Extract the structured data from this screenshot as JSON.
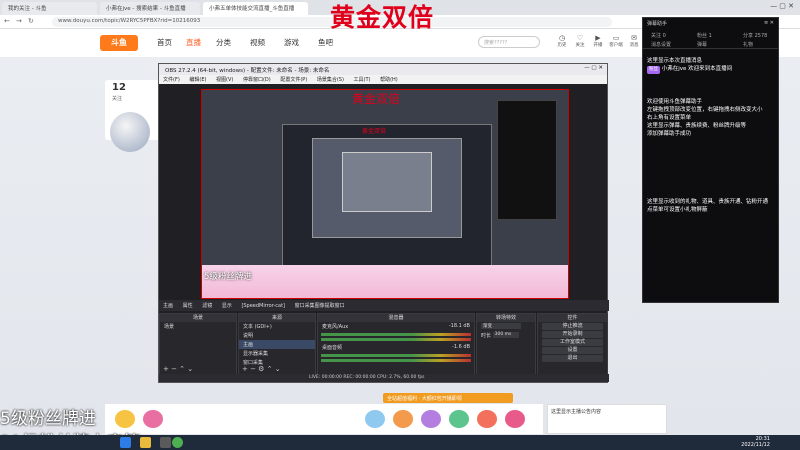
{
  "browser": {
    "tabs": [
      "我的关注 - 斗鱼",
      "小弗在jve - 搜索结果 - 斗鱼直播",
      "小弗五单体技能交流直播_斗鱼直播"
    ],
    "url": "www.douyu.com/topic/W2RYC5PFBX?rid=10216093"
  },
  "overlay": {
    "title": "黄金双倍",
    "fans_line1": "5级粉丝牌进",
    "fans_line2": "21级粉丝牌上房管"
  },
  "site": {
    "logo": "斗鱼",
    "nav": [
      "首页",
      "直播",
      "分类",
      "视频",
      "游戏",
      "鱼吧"
    ],
    "search_placeholder": "搜索?????",
    "header_icons": [
      "历史",
      "关注",
      "开播",
      "客户端",
      "消息"
    ],
    "side_count": "12",
    "side_count_label": "关注"
  },
  "obs": {
    "title": "OBS 27.2.4 (64-bit, windows) - 配置文件: 未命名 - 场景: 未命名",
    "menu": [
      "文件(F)",
      "编辑(E)",
      "视图(V)",
      "停靠窗口(D)",
      "配置文件(P)",
      "场景集合(S)",
      "工具(T)",
      "帮助(H)"
    ],
    "preview_title": "黄金双倍",
    "nested_title": "黄金双倍",
    "scene_line": [
      "主画",
      "属性",
      "滤镜",
      "显示",
      "[SpeedMirror-cat]",
      "窗口采集图像提取窗口"
    ],
    "docks": {
      "scenes": {
        "title": "场景",
        "items": [
          "场景"
        ]
      },
      "sources": {
        "title": "来源",
        "items": [
          "文本 (GDI+)",
          "说明",
          "主画",
          "显示器采集",
          "窗口采集"
        ]
      },
      "mixer": {
        "title": "混音器",
        "items": [
          "麦克风/Aux",
          "桌面音频"
        ],
        "levels": [
          "-18.1 dB",
          "-1.6 dB"
        ]
      },
      "transitions": {
        "title": "转场特效",
        "items": [
          "渐变",
          "时长"
        ],
        "duration": "300 ms"
      },
      "controls": {
        "title": "控件",
        "buttons": [
          "停止推流",
          "开始录制",
          "工作室模式",
          "设置",
          "退出"
        ]
      }
    },
    "status": "LIVE: 00:00:00  REC: 00:00:00  CPU: 2.7%, 60.00 fps"
  },
  "chat": {
    "header": "弹幕助手",
    "tabs": [
      "关注",
      "粉丝",
      "分享"
    ],
    "tab_values": [
      "0",
      "1",
      "2578"
    ],
    "sub_tabs": [
      "消息设置",
      "弹幕",
      "礼物"
    ],
    "messages": [
      "这里显示本次直播消息",
      "小弗在jve 欢迎来到本直播间",
      "欢迎使用斗鱼弹幕助手",
      "左键拖拽顶部改变位置，右键拖拽右侧改变大小",
      "右上角有设置菜单",
      "这里显示弹幕、贵族续费、粉丝牌升级等",
      "添加弹幕助手成功",
      "这里显示收到的礼物、道具、贵族开通、钻粉开通",
      "点菜单可设置小礼物屏蔽"
    ],
    "badge": "粉丝"
  },
  "bottom": {
    "promo": "全站超值福利 · 大额红包开播即领",
    "panel_text": "这里显示主播公告内容"
  },
  "taskbar": {
    "time": "20:31",
    "date": "2022/11/12"
  }
}
